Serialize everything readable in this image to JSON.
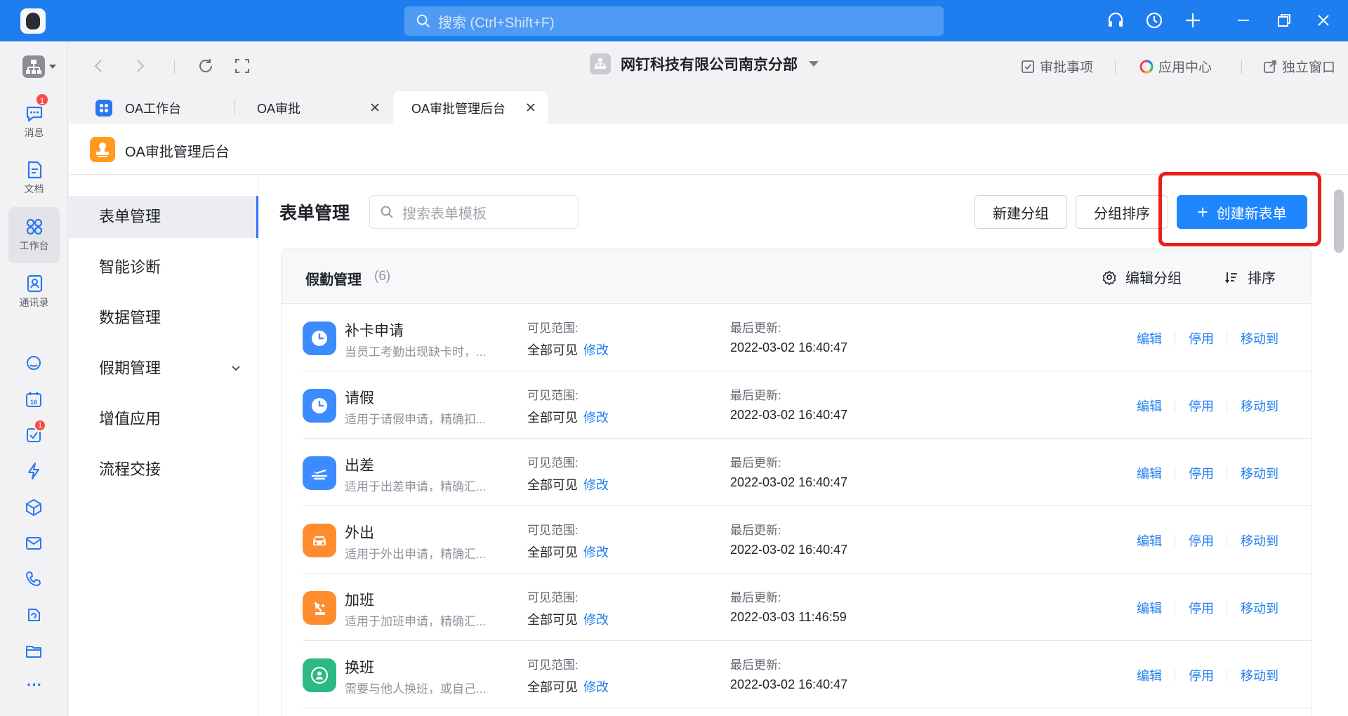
{
  "titlebar": {
    "search_placeholder": "搜索 (Ctrl+Shift+F)",
    "accent_color": "#1e7ef0",
    "icons": [
      "headset-icon",
      "history-icon",
      "plus-icon",
      "minimize-icon",
      "restore-icon",
      "close-icon"
    ]
  },
  "rail": {
    "items": [
      {
        "label": "消息",
        "icon": "chat-icon",
        "badge": "1"
      },
      {
        "label": "文档",
        "icon": "document-icon"
      },
      {
        "label": "工作台",
        "icon": "grid-icon",
        "active": true
      },
      {
        "label": "通讯录",
        "icon": "contacts-icon"
      }
    ],
    "todo_badge": "1",
    "calendar_day": "16",
    "more": "···"
  },
  "header": {
    "org_name": "网钉科技有限公司南京分部",
    "links": [
      "审批事项",
      "应用中心",
      "独立窗口"
    ]
  },
  "tabs": [
    {
      "label": "OA工作台",
      "active": false
    },
    {
      "label": "OA审批",
      "active": false
    },
    {
      "label": "OA审批管理后台",
      "active": true
    }
  ],
  "page": {
    "title": "OA审批管理后台"
  },
  "subnav": [
    {
      "label": "表单管理",
      "active": true
    },
    {
      "label": "智能诊断"
    },
    {
      "label": "数据管理"
    },
    {
      "label": "假期管理",
      "expandable": true
    },
    {
      "label": "增值应用"
    },
    {
      "label": "流程交接"
    }
  ],
  "main": {
    "title": "表单管理",
    "search_placeholder": "搜索表单模板",
    "new_group": "新建分组",
    "sort_groups": "分组排序",
    "create_form": "创建新表单"
  },
  "group": {
    "name": "假勤管理",
    "count": "(6)",
    "edit_group": "编辑分组",
    "sort": "排序"
  },
  "labels": {
    "visibility": "可见范围:",
    "updated": "最后更新:",
    "modify": "修改",
    "edit": "编辑",
    "disable": "停用",
    "move": "移动到"
  },
  "forms": [
    {
      "name": "补卡申请",
      "desc": "当员工考勤出现缺卡时，...",
      "visibility": "全部可见",
      "updated": "2022-03-02 16:40:47",
      "icon": "clock-icon",
      "color": "#3c8cff"
    },
    {
      "name": "请假",
      "desc": "适用于请假申请，精确扣...",
      "visibility": "全部可见",
      "updated": "2022-03-02 16:40:47",
      "icon": "clock-icon",
      "color": "#3c8cff"
    },
    {
      "name": "出差",
      "desc": "适用于出差申请，精确汇...",
      "visibility": "全部可见",
      "updated": "2022-03-02 16:40:47",
      "icon": "plane-icon",
      "color": "#3c8cff"
    },
    {
      "name": "外出",
      "desc": "适用于外出申请，精确汇...",
      "visibility": "全部可见",
      "updated": "2022-03-02 16:40:47",
      "icon": "car-icon",
      "color": "#ff8c2e"
    },
    {
      "name": "加班",
      "desc": "适用于加班申请，精确汇...",
      "visibility": "全部可见",
      "updated": "2022-03-03 11:46:59",
      "icon": "lamp-icon",
      "color": "#ff8c2e"
    },
    {
      "name": "换班",
      "desc": "需要与他人换班，或自己...",
      "visibility": "全部可见",
      "updated": "2022-03-02 16:40:47",
      "icon": "swap-person-icon",
      "color": "#2bba84"
    }
  ]
}
